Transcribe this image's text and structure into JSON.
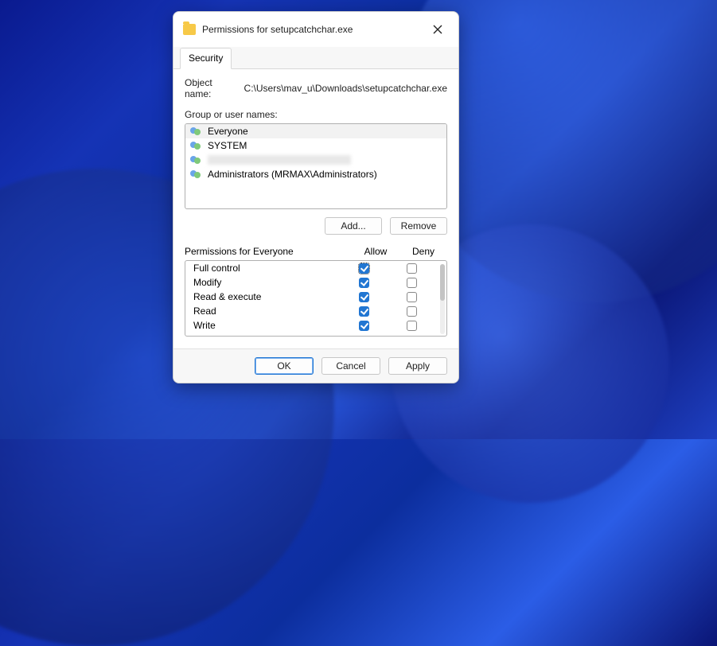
{
  "window": {
    "title": "Permissions for setupcatchchar.exe"
  },
  "tabs": {
    "security": "Security"
  },
  "object": {
    "label": "Object name:",
    "path": "C:\\Users\\mav_u\\Downloads\\setupcatchchar.exe"
  },
  "groups": {
    "label": "Group or user names:",
    "items": [
      {
        "name": "Everyone",
        "selected": true,
        "redacted": false
      },
      {
        "name": "SYSTEM",
        "selected": false,
        "redacted": false
      },
      {
        "name": "",
        "selected": false,
        "redacted": true
      },
      {
        "name": "Administrators (MRMAX\\Administrators)",
        "selected": false,
        "redacted": false
      }
    ]
  },
  "buttons": {
    "add": "Add...",
    "remove": "Remove",
    "ok": "OK",
    "cancel": "Cancel",
    "apply": "Apply"
  },
  "perm_header": {
    "title": "Permissions for Everyone",
    "allow": "Allow",
    "deny": "Deny"
  },
  "permissions": [
    {
      "name": "Full control",
      "allow": true,
      "deny": false
    },
    {
      "name": "Modify",
      "allow": true,
      "deny": false
    },
    {
      "name": "Read & execute",
      "allow": true,
      "deny": false
    },
    {
      "name": "Read",
      "allow": true,
      "deny": false
    },
    {
      "name": "Write",
      "allow": true,
      "deny": false
    }
  ]
}
